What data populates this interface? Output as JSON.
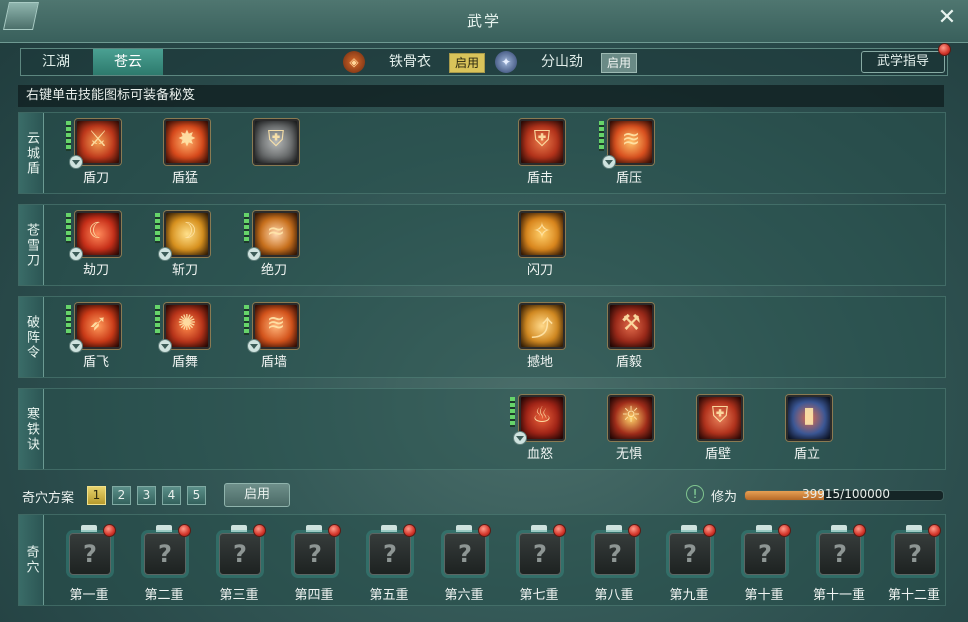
{
  "window": {
    "title": "武学"
  },
  "tabs": [
    {
      "label": "江湖",
      "active": false
    },
    {
      "label": "苍云",
      "active": true
    }
  ],
  "stances": [
    {
      "name": "铁骨衣",
      "badge": "启用",
      "badge_color": "#d9c35a",
      "icon": "shield-stance-icon"
    },
    {
      "name": "分山劲",
      "badge": "启用",
      "badge_color": "#6a8a86",
      "icon": "blade-stance-icon"
    }
  ],
  "guide_button": "武学指导",
  "hint": "右键单击技能图标可装备秘笈",
  "skill_rows": [
    {
      "label": "云城盾",
      "skills": [
        {
          "name": "盾刀",
          "color": "#c0391c",
          "level": true
        },
        {
          "name": "盾猛",
          "color": "#d84a1c",
          "level": false
        },
        {
          "name": "",
          "color": "#6c6f70",
          "level": false
        },
        {
          "name": "盾击",
          "color": "#b3331b",
          "level": false
        },
        {
          "name": "盾压",
          "color": "#d9501f",
          "level": true
        }
      ]
    },
    {
      "label": "苍雪刀",
      "skills": [
        {
          "name": "劫刀",
          "color": "#c8301a",
          "level": true
        },
        {
          "name": "斩刀",
          "color": "#d8921f",
          "level": true
        },
        {
          "name": "绝刀",
          "color": "#c8701d",
          "level": true
        },
        {
          "name": "闪刀",
          "color": "#d9861d",
          "level": false
        }
      ]
    },
    {
      "label": "破阵令",
      "skills": [
        {
          "name": "盾飞",
          "color": "#cc3b18",
          "level": true
        },
        {
          "name": "盾舞",
          "color": "#b9341a",
          "level": true
        },
        {
          "name": "盾墙",
          "color": "#d4541c",
          "level": true
        },
        {
          "name": "撼地",
          "color": "#d28a22",
          "level": false
        },
        {
          "name": "盾毅",
          "color": "#9c2a1a",
          "level": false
        }
      ]
    },
    {
      "label": "寒铁诀",
      "skills": [
        {
          "name": "血怒",
          "color": "#a12417",
          "level": true
        },
        {
          "name": "无惧",
          "color": "#a42e1b",
          "level": false
        },
        {
          "name": "盾壁",
          "color": "#b3331d",
          "level": false
        },
        {
          "name": "盾立",
          "color": "#3d5a9a",
          "level": false
        }
      ]
    }
  ],
  "plan": {
    "label": "奇穴方案",
    "numbers": [
      "1",
      "2",
      "3",
      "4",
      "5"
    ],
    "active_index": 0,
    "enable_button": "启用"
  },
  "xiuwei": {
    "label": "修为",
    "text": "39915/100000",
    "fraction": 0.39915
  },
  "qixue": {
    "label": "奇穴",
    "slots": [
      "第一重",
      "第二重",
      "第三重",
      "第四重",
      "第五重",
      "第六重",
      "第七重",
      "第八重",
      "第九重",
      "第十重",
      "第十一重",
      "第十二重"
    ],
    "placeholder": "?"
  }
}
